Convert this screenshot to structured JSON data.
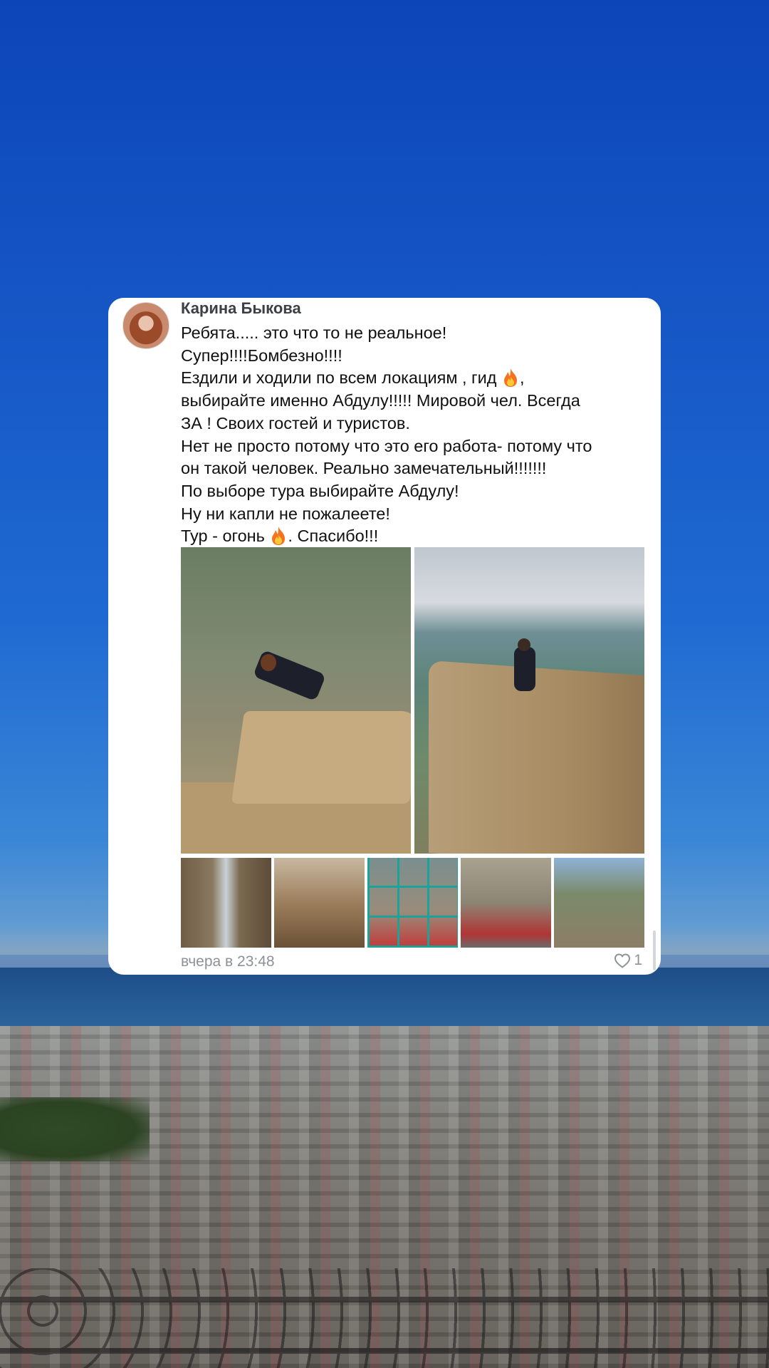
{
  "comment": {
    "author": "Карина Быкова",
    "lines": [
      "Ребята..... это что то не реальное!",
      "Супер!!!!Бомбезно!!!!",
      "Ездили и ходили по всем локациям , гид",
      "выбирайте именно Абдулу!!!!! Мировой чел. Всегда",
      "ЗА ! Своих гостей и туристов.",
      "Нет не просто потому что это его работа- потому что",
      "он такой человек. Реально замечательный!!!!!!!",
      "По выборе тура выбирайте Абдулу!",
      "Ну ни капли не пожалеете!",
      "Тур - огонь",
      ". Спасибо!!!"
    ],
    "timestamp": "вчера в 23:48",
    "like_count": "1",
    "icons": {
      "fire": "fire-emoji-icon",
      "heart": "heart-outline-icon"
    }
  },
  "colors": {
    "card": "#ffffff",
    "author": "#3c3f44",
    "meta": "#8e9196",
    "sky": "#1657c6"
  }
}
